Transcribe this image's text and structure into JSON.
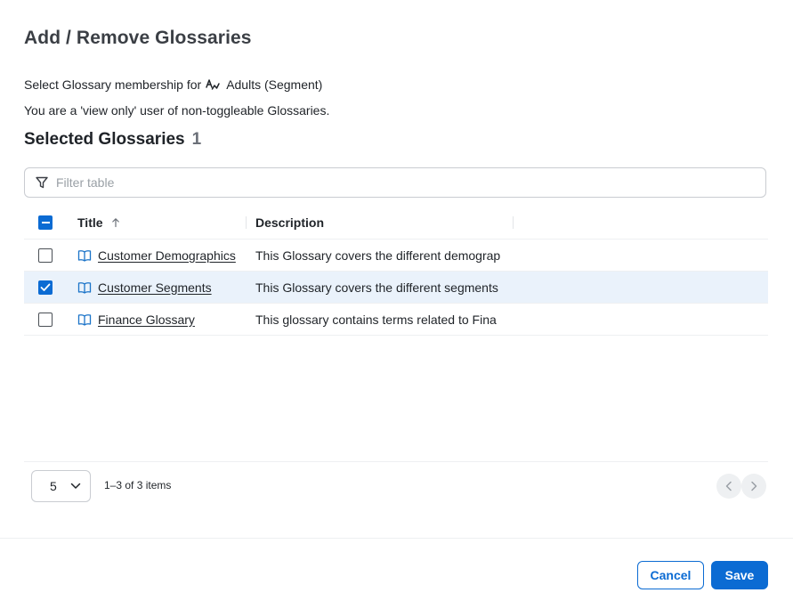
{
  "dialog": {
    "title": "Add / Remove Glossaries",
    "membership_prefix": "Select Glossary membership for",
    "segment_icon": "segment-icon",
    "segment_name": "Adults (Segment)",
    "view_only_note": "You are a 'view only' user of non-toggleable Glossaries.",
    "section_title": "Selected Glossaries",
    "selected_count": "1"
  },
  "filter": {
    "placeholder": "Filter table",
    "value": "",
    "icon": "filter-icon"
  },
  "table": {
    "columns": [
      "Title",
      "Description"
    ],
    "sort_icon": "arrow-up-icon",
    "header_checkbox_state": "indeterminate",
    "rows": [
      {
        "title": "Customer Demographics",
        "description": "This Glossary covers the different demograp",
        "checked": false,
        "icon": "book-icon"
      },
      {
        "title": "Customer Segments",
        "description": "This Glossary covers the different segments",
        "checked": true,
        "icon": "book-icon"
      },
      {
        "title": "Finance Glossary",
        "description": "This glossary contains terms related to Fina",
        "checked": false,
        "icon": "book-icon"
      }
    ]
  },
  "pagination": {
    "page_size": "5",
    "range_text": "1–3 of 3 items",
    "prev_icon": "chevron-left-icon",
    "next_icon": "chevron-right-icon"
  },
  "footer": {
    "cancel_label": "Cancel",
    "save_label": "Save"
  },
  "colors": {
    "accent": "#0b6bd3",
    "selected_row": "#eaf2fb",
    "link_icon": "#1a73c8"
  }
}
